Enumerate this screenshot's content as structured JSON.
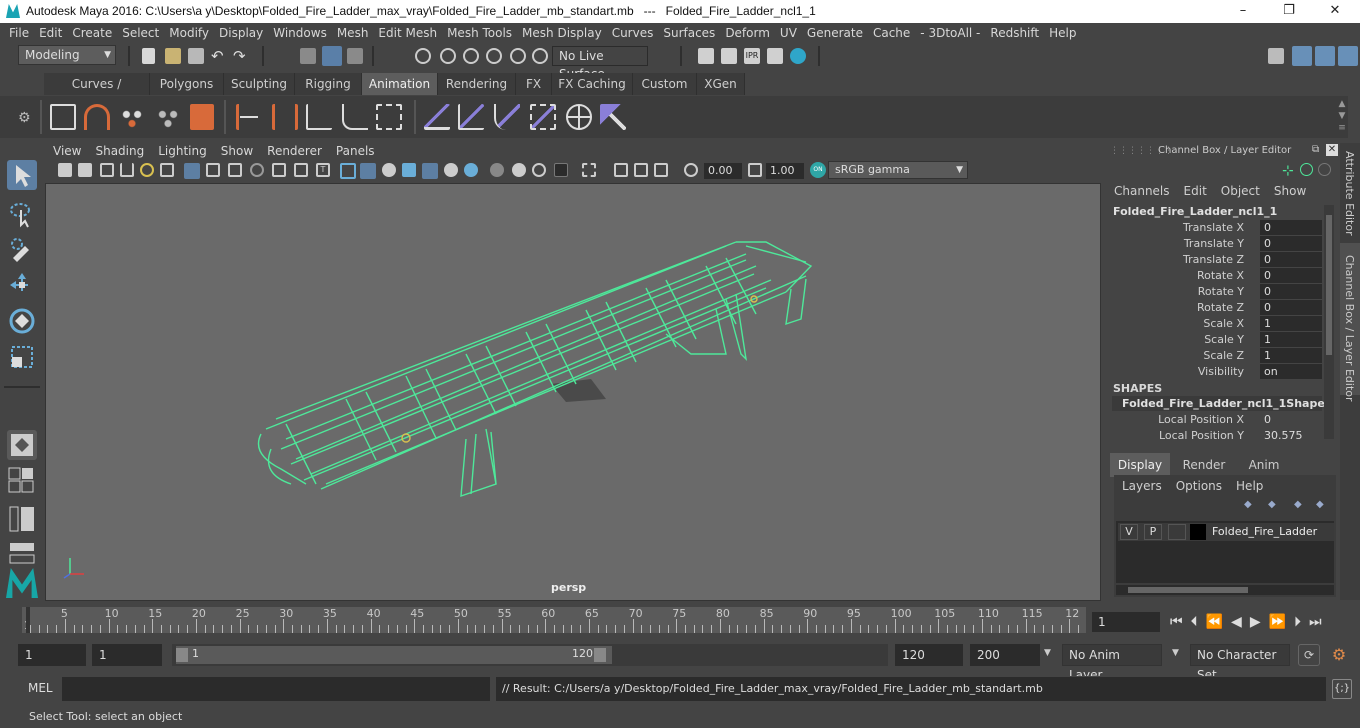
{
  "window": {
    "title": "Autodesk Maya 2016: C:\\Users\\a y\\Desktop\\Folded_Fire_Ladder_max_vray\\Folded_Fire_Ladder_mb_standart.mb   ---   Folded_Fire_Ladder_ncl1_1",
    "minimize": "–",
    "maximize": "❐",
    "close": "✕"
  },
  "menus": [
    "File",
    "Edit",
    "Create",
    "Select",
    "Modify",
    "Display",
    "Windows",
    "Mesh",
    "Edit Mesh",
    "Mesh Tools",
    "Mesh Display",
    "Curves",
    "Surfaces",
    "Deform",
    "UV",
    "Generate",
    "Cache",
    "- 3DtoAll -",
    "Redshift",
    "Help"
  ],
  "statusline": {
    "menuset": "Modeling",
    "live_surface": "No Live Surface"
  },
  "shelf_tabs": [
    "Curves / Surfaces",
    "Polygons",
    "Sculpting",
    "Rigging",
    "Animation",
    "Rendering",
    "FX",
    "FX Caching",
    "Custom",
    "XGen"
  ],
  "shelf_active": "Animation",
  "viewport": {
    "menus": [
      "View",
      "Shading",
      "Lighting",
      "Show",
      "Renderer",
      "Panels"
    ],
    "exposure": "0.00",
    "gamma": "1.00",
    "colorspace": "sRGB gamma",
    "camera_label": "persp"
  },
  "channelbox": {
    "header": "Channel Box / Layer Editor",
    "menus": [
      "Channels",
      "Edit",
      "Object",
      "Show"
    ],
    "object_name": "Folded_Fire_Ladder_ncl1_1",
    "attributes": [
      {
        "label": "Translate X",
        "value": "0"
      },
      {
        "label": "Translate Y",
        "value": "0"
      },
      {
        "label": "Translate Z",
        "value": "0"
      },
      {
        "label": "Rotate X",
        "value": "0"
      },
      {
        "label": "Rotate Y",
        "value": "0"
      },
      {
        "label": "Rotate Z",
        "value": "0"
      },
      {
        "label": "Scale X",
        "value": "1"
      },
      {
        "label": "Scale Y",
        "value": "1"
      },
      {
        "label": "Scale Z",
        "value": "1"
      },
      {
        "label": "Visibility",
        "value": "on"
      }
    ],
    "shapes_title": "SHAPES",
    "shape_name": "Folded_Fire_Ladder_ncl1_1Shape",
    "shape_attributes": [
      {
        "label": "Local Position X",
        "value": "0"
      },
      {
        "label": "Local Position Y",
        "value": "30.575"
      }
    ],
    "layer_tabs": [
      "Display",
      "Render",
      "Anim"
    ],
    "layer_menus": [
      "Layers",
      "Options",
      "Help"
    ],
    "layer": {
      "v": "V",
      "p": "P",
      "name": "Folded_Fire_Ladder"
    }
  },
  "side_tabs": [
    "Attribute Editor",
    "Channel Box / Layer Editor"
  ],
  "timeline": {
    "ticks": [
      "5",
      "10",
      "15",
      "20",
      "25",
      "30",
      "35",
      "40",
      "45",
      "50",
      "55",
      "60",
      "65",
      "70",
      "75",
      "80",
      "85",
      "90",
      "95",
      "100",
      "105",
      "110",
      "115",
      "12"
    ],
    "start_marker": "1",
    "current_frame": "1"
  },
  "range": {
    "start": "1",
    "playback_start": "1",
    "slider_start": "1",
    "slider_end": "120",
    "playback_end": "120",
    "end": "200",
    "anim_layer": "No Anim Layer",
    "character_set": "No Character Set"
  },
  "command": {
    "language": "MEL",
    "result": "// Result: C:/Users/a y/Desktop/Folded_Fire_Ladder_max_vray/Folded_Fire_Ladder_mb_standart.mb"
  },
  "helpline": "Select Tool: select an object",
  "colors": {
    "wireframe": "#4ee89a",
    "active_tab": "#5d5d5d",
    "viewport_bg": "#6a6a6a",
    "layer_color": "#000000"
  }
}
